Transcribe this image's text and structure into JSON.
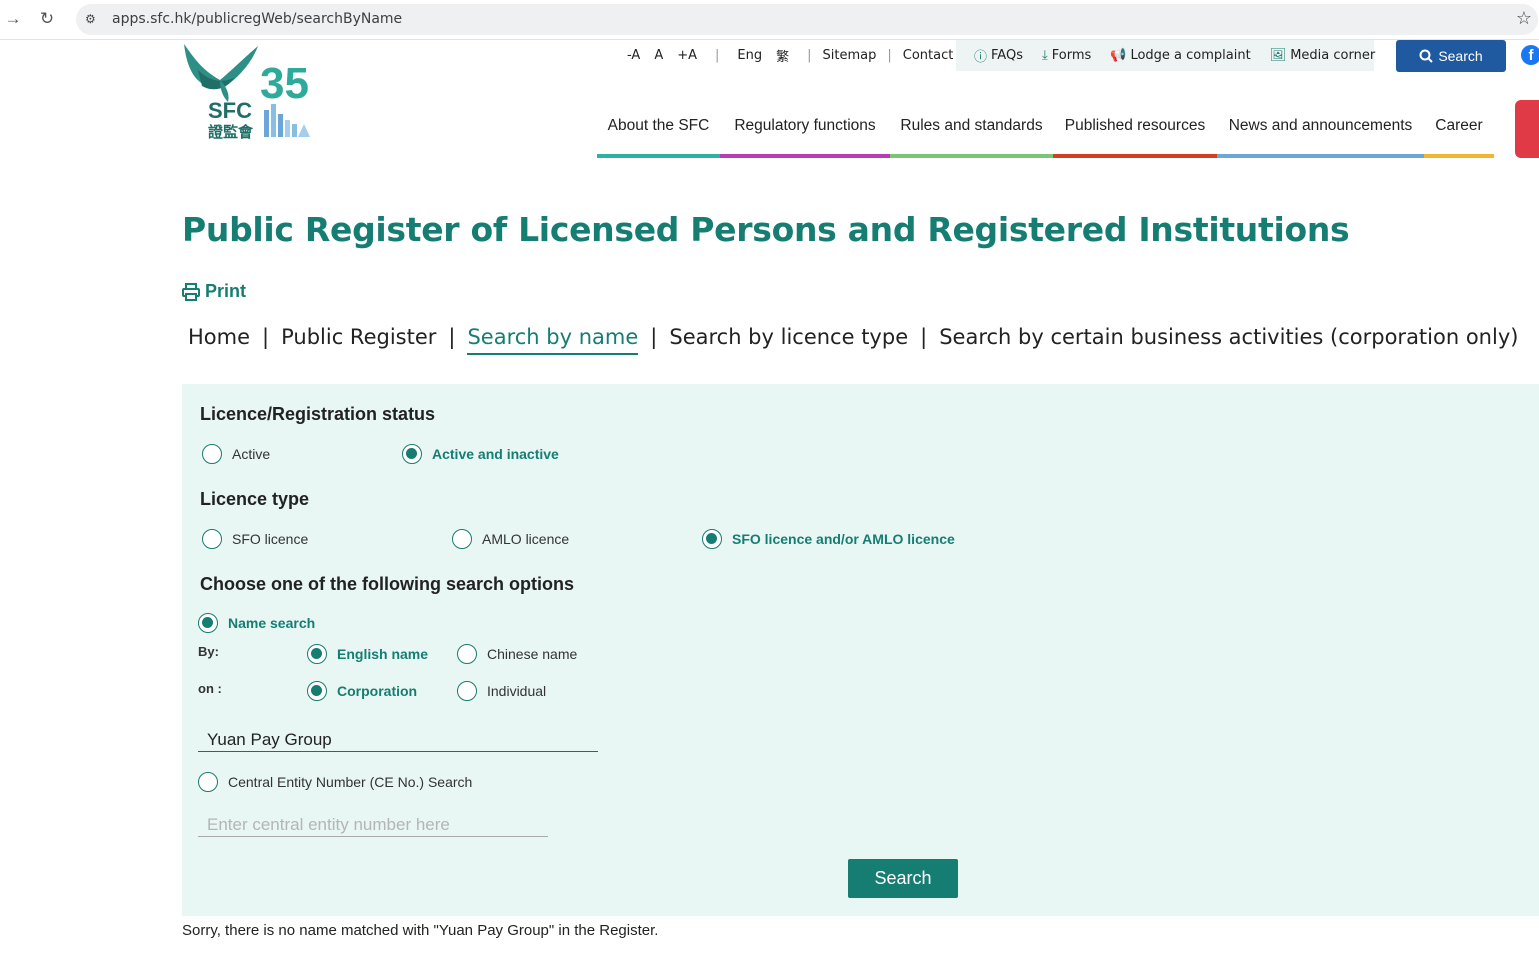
{
  "browser": {
    "url": "apps.sfc.hk/publicregWeb/searchByName"
  },
  "logo": {
    "org": "SFC",
    "chinese": "證監會",
    "anniversary": "35"
  },
  "utility": {
    "font_smaller": "-A",
    "font_normal": "A",
    "font_larger": "+A",
    "lang_en": "Eng",
    "lang_tc": "繁",
    "sitemap": "Sitemap",
    "contact": "Contact us",
    "faqs": "FAQs",
    "forms": "Forms",
    "complaint": "Lodge a complaint",
    "media": "Media corner",
    "search": "Search"
  },
  "nav": [
    {
      "label": "About the SFC",
      "color": "#2bb3a0"
    },
    {
      "label": "Regulatory functions",
      "color": "#b83db3"
    },
    {
      "label": "Rules and standards",
      "color": "#7cc576"
    },
    {
      "label": "Published resources",
      "color": "#d4401f"
    },
    {
      "label": "News and announcements",
      "color": "#6aa7d8"
    },
    {
      "label": "Career",
      "color": "#f2b531"
    }
  ],
  "page": {
    "title": "Public Register of Licensed Persons and Registered Institutions",
    "print": "Print"
  },
  "breadcrumb": {
    "home": "Home",
    "register": "Public Register",
    "by_name": "Search by name",
    "by_licence": "Search by licence type",
    "by_activity": "Search by certain business activities (corporation only)"
  },
  "form": {
    "status_heading": "Licence/Registration status",
    "status_active": "Active",
    "status_all": "Active and inactive",
    "type_heading": "Licence type",
    "type_sfo": "SFO licence",
    "type_amlo": "AMLO licence",
    "type_both": "SFO licence and/or AMLO licence",
    "options_heading": "Choose one of the following search options",
    "name_search": "Name search",
    "by_label": "By:",
    "by_english": "English name",
    "by_chinese": "Chinese name",
    "on_label": "on :",
    "on_corporation": "Corporation",
    "on_individual": "Individual",
    "name_value": "Yuan Pay Group",
    "ce_search": "Central Entity Number (CE No.) Search",
    "ce_placeholder": "Enter central entity number here",
    "submit": "Search"
  },
  "result": {
    "message": "Sorry, there is no name matched with \"Yuan Pay Group\" in the Register."
  },
  "colors": {
    "brand_teal": "#167d73",
    "panel_bg": "#e8f6f4",
    "search_blue": "#1f5aa0"
  }
}
